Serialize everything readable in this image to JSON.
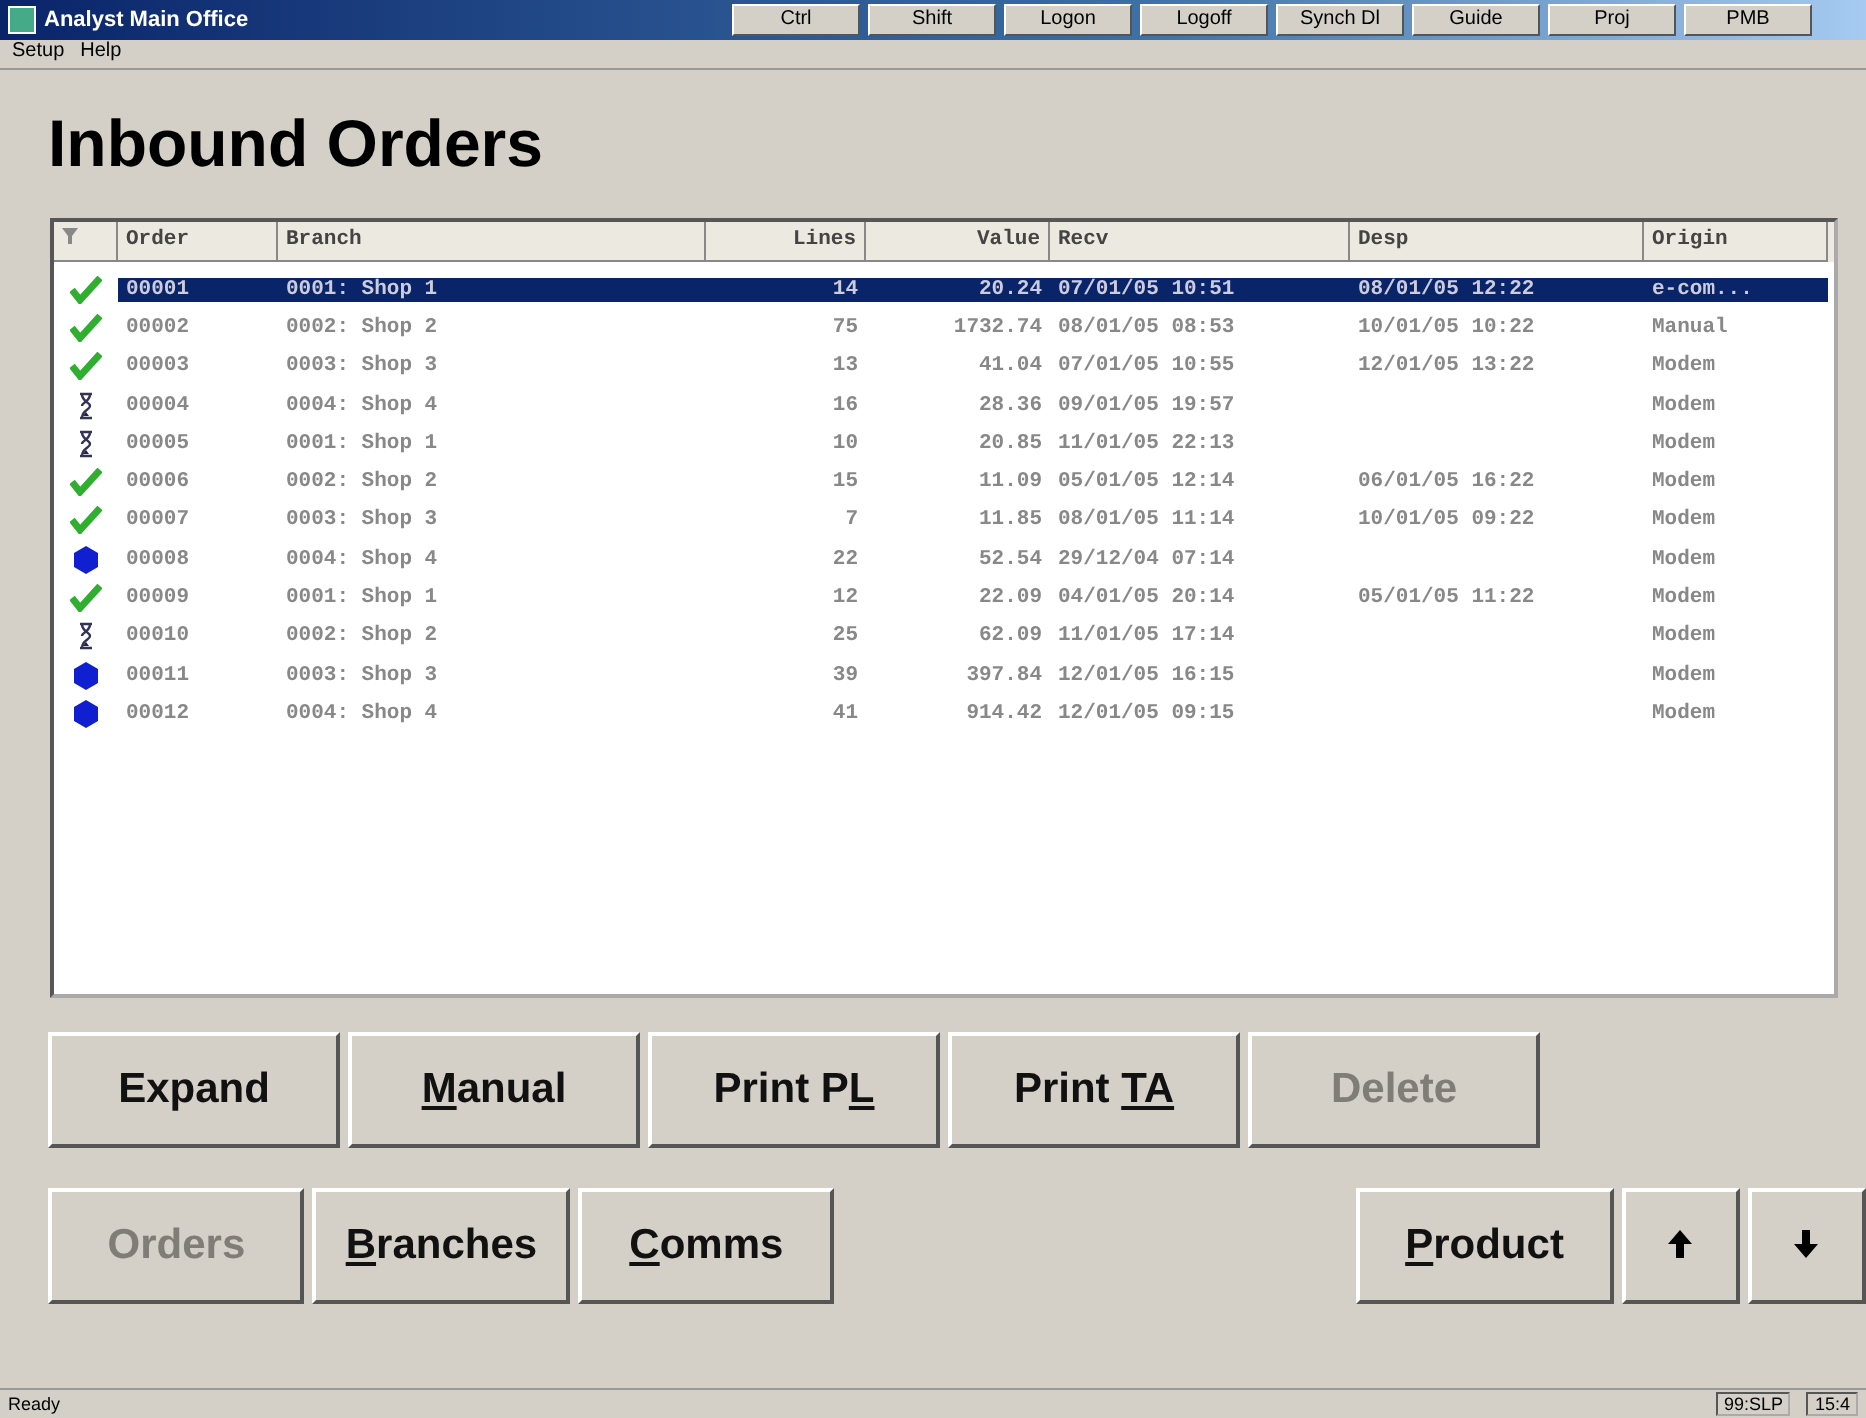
{
  "window": {
    "title": "Analyst Main Office",
    "toolbar": [
      "Ctrl",
      "Shift",
      "Logon",
      "Logoff",
      "Synch Dl",
      "Guide",
      "Proj",
      "PMB"
    ]
  },
  "menu": [
    "Setup",
    "Help"
  ],
  "heading": "Inbound Orders",
  "table": {
    "columns": [
      "Order",
      "Branch",
      "Lines",
      "Value",
      "Recv",
      "Desp",
      "Origin"
    ],
    "rows": [
      {
        "kind": "done",
        "selected": true,
        "cells": [
          "00001",
          "0001: Shop 1",
          "14",
          "20.24",
          "07/01/05 10:51",
          "08/01/05 12:22",
          "e-com..."
        ]
      },
      {
        "kind": "done",
        "selected": false,
        "cells": [
          "00002",
          "0002: Shop 2",
          "75",
          "1732.74",
          "08/01/05 08:53",
          "10/01/05 10:22",
          "Manual"
        ]
      },
      {
        "kind": "done",
        "selected": false,
        "cells": [
          "00003",
          "0003: Shop 3",
          "13",
          "41.04",
          "07/01/05 10:55",
          "12/01/05 13:22",
          "Modem"
        ]
      },
      {
        "kind": "pending",
        "selected": false,
        "cells": [
          "00004",
          "0004: Shop 4",
          "16",
          "28.36",
          "09/01/05 19:57",
          null,
          "Modem"
        ]
      },
      {
        "kind": "pending",
        "selected": false,
        "cells": [
          "00005",
          "0001: Shop 1",
          "10",
          "20.85",
          "11/01/05 22:13",
          null,
          "Modem"
        ]
      },
      {
        "kind": "done",
        "selected": false,
        "cells": [
          "00006",
          "0002: Shop 2",
          "15",
          "11.09",
          "05/01/05 12:14",
          "06/01/05 16:22",
          "Modem"
        ]
      },
      {
        "kind": "done",
        "selected": false,
        "cells": [
          "00007",
          "0003: Shop 3",
          "7",
          "11.85",
          "08/01/05 11:14",
          "10/01/05 09:22",
          "Modem"
        ]
      },
      {
        "kind": "new",
        "selected": false,
        "cells": [
          "00008",
          "0004: Shop 4",
          "22",
          "52.54",
          "29/12/04 07:14",
          null,
          "Modem"
        ]
      },
      {
        "kind": "done",
        "selected": false,
        "cells": [
          "00009",
          "0001: Shop 1",
          "12",
          "22.09",
          "04/01/05 20:14",
          "05/01/05 11:22",
          "Modem"
        ]
      },
      {
        "kind": "pending",
        "selected": false,
        "cells": [
          "00010",
          "0002: Shop 2",
          "25",
          "62.09",
          "11/01/05 17:14",
          null,
          "Modem"
        ]
      },
      {
        "kind": "new",
        "selected": false,
        "cells": [
          "00011",
          "0003: Shop 3",
          "39",
          "397.84",
          "12/01/05 16:15",
          null,
          "Modem"
        ]
      },
      {
        "kind": "new",
        "selected": false,
        "cells": [
          "00012",
          "0004: Shop 4",
          "41",
          "914.42",
          "12/01/05 09:15",
          null,
          "Modem"
        ]
      }
    ]
  },
  "buttons_top": [
    {
      "kind": "text",
      "pre": "Expand",
      "disabled": false
    },
    {
      "kind": "text",
      "key": "M",
      "post": "anual",
      "disabled": false
    },
    {
      "kind": "text",
      "pre": "Print P",
      "key": "L",
      "disabled": false
    },
    {
      "kind": "text",
      "pre": "Print ",
      "key": "TA",
      "disabled": false
    },
    {
      "kind": "text",
      "pre": "Delete",
      "disabled": true
    }
  ],
  "buttons_bottom": [
    {
      "kind": "text",
      "pre": "Orders",
      "disabled": true
    },
    {
      "kind": "text",
      "key": "B",
      "post": "ranches",
      "disabled": false
    },
    {
      "kind": "text",
      "key": "C",
      "post": "omms",
      "disabled": false
    },
    {
      "kind": "spacer"
    },
    {
      "kind": "text",
      "key": "P",
      "post": "roduct",
      "disabled": false
    },
    {
      "kind": "up"
    },
    {
      "kind": "down"
    }
  ],
  "status_bar": {
    "text": "Ready",
    "panels": [
      "99:SLP",
      "15:4"
    ]
  }
}
